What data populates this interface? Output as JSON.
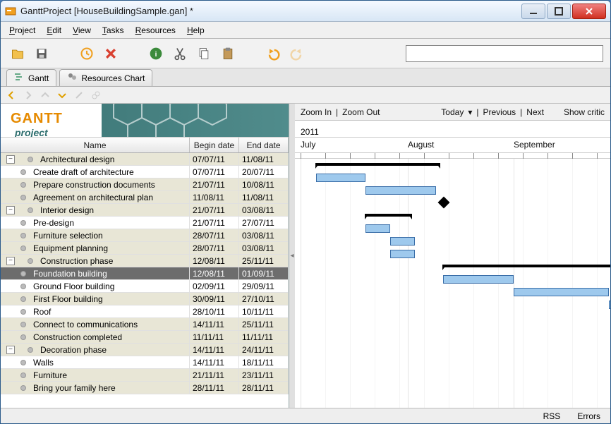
{
  "title": "GanttProject [HouseBuildingSample.gan] *",
  "menu": [
    "Project",
    "Edit",
    "View",
    "Tasks",
    "Resources",
    "Help"
  ],
  "menuAccel": [
    "P",
    "E",
    "V",
    "T",
    "R",
    "H"
  ],
  "tabs": {
    "gantt": "Gantt",
    "resources": "Resources Chart"
  },
  "tableHeaders": {
    "name": "Name",
    "begin": "Begin date",
    "end": "End date"
  },
  "timeline": {
    "zoomIn": "Zoom In",
    "zoomOut": "Zoom Out",
    "today": "Today",
    "previous": "Previous",
    "next": "Next",
    "showCritical": "Show critic",
    "year": "2011",
    "months": [
      "July",
      "August",
      "September"
    ]
  },
  "status": {
    "rss": "RSS",
    "errors": "Errors"
  },
  "logo": {
    "brand": "GANTT",
    "sub": "project"
  },
  "searchPlaceholder": "",
  "tasks": [
    {
      "lvl": 0,
      "exp": true,
      "name": "Architectural design",
      "begin": "07/07/11",
      "end": "11/08/11",
      "type": "summary",
      "start": 30,
      "dur": 175,
      "cls": "parent"
    },
    {
      "lvl": 1,
      "name": "Create draft of architecture",
      "begin": "07/07/11",
      "end": "20/07/11",
      "type": "bar",
      "start": 30,
      "dur": 70,
      "cls": ""
    },
    {
      "lvl": 1,
      "name": "Prepare construction documents",
      "begin": "21/07/11",
      "end": "10/08/11",
      "type": "bar",
      "start": 100,
      "dur": 100,
      "cls": "alt"
    },
    {
      "lvl": 1,
      "name": "Agreement on architectural plan",
      "begin": "11/08/11",
      "end": "11/08/11",
      "type": "milestone",
      "start": 205,
      "cls": "alt"
    },
    {
      "lvl": 0,
      "exp": true,
      "name": "Interior design",
      "begin": "21/07/11",
      "end": "03/08/11",
      "type": "summary",
      "start": 100,
      "dur": 65,
      "cls": "parent"
    },
    {
      "lvl": 1,
      "name": "Pre-design",
      "begin": "21/07/11",
      "end": "27/07/11",
      "type": "bar",
      "start": 100,
      "dur": 35,
      "cls": ""
    },
    {
      "lvl": 1,
      "name": "Furniture selection",
      "begin": "28/07/11",
      "end": "03/08/11",
      "type": "bar",
      "start": 135,
      "dur": 35,
      "cls": "alt"
    },
    {
      "lvl": 1,
      "name": "Equipment planning",
      "begin": "28/07/11",
      "end": "03/08/11",
      "type": "bar",
      "start": 135,
      "dur": 35,
      "cls": "alt"
    },
    {
      "lvl": 0,
      "exp": true,
      "name": "Construction phase",
      "begin": "12/08/11",
      "end": "25/11/11",
      "type": "summary",
      "start": 210,
      "dur": 420,
      "cls": "parent"
    },
    {
      "lvl": 1,
      "name": "Foundation building",
      "begin": "12/08/11",
      "end": "01/09/11",
      "type": "bar",
      "start": 210,
      "dur": 100,
      "cls": "sel",
      "selected": true
    },
    {
      "lvl": 1,
      "name": "Ground Floor building",
      "begin": "02/09/11",
      "end": "29/09/11",
      "type": "bar",
      "start": 310,
      "dur": 135,
      "cls": ""
    },
    {
      "lvl": 1,
      "name": "First Floor building",
      "begin": "30/09/11",
      "end": "27/10/11",
      "type": "bar",
      "start": 445,
      "dur": 140,
      "cls": "alt"
    },
    {
      "lvl": 1,
      "name": "Roof",
      "begin": "28/10/11",
      "end": "10/11/11",
      "type": "bar",
      "start": 585,
      "dur": 70,
      "cls": ""
    },
    {
      "lvl": 1,
      "name": "Connect to communications",
      "begin": "14/11/11",
      "end": "25/11/11",
      "type": "bar",
      "start": 660,
      "dur": 60,
      "cls": "alt"
    },
    {
      "lvl": 1,
      "name": "Construction completed",
      "begin": "11/11/11",
      "end": "11/11/11",
      "type": "milestone",
      "start": 655,
      "cls": "alt"
    },
    {
      "lvl": 0,
      "exp": true,
      "name": "Decoration phase",
      "begin": "14/11/11",
      "end": "24/11/11",
      "type": "summary",
      "start": 660,
      "dur": 55,
      "cls": "parent"
    },
    {
      "lvl": 1,
      "name": "Walls",
      "begin": "14/11/11",
      "end": "18/11/11",
      "type": "bar",
      "start": 660,
      "dur": 25,
      "cls": ""
    },
    {
      "lvl": 1,
      "name": "Furniture",
      "begin": "21/11/11",
      "end": "23/11/11",
      "type": "bar",
      "start": 695,
      "dur": 15,
      "cls": "alt"
    },
    {
      "lvl": 1,
      "name": "Bring your family here",
      "begin": "28/11/11",
      "end": "28/11/11",
      "type": "milestone",
      "start": 720,
      "cls": "alt"
    }
  ],
  "chart_data": {
    "type": "gantt",
    "title": "HouseBuildingSample",
    "time_axis": {
      "year": 2011,
      "months_visible": [
        "July",
        "August",
        "September"
      ]
    },
    "tasks": [
      {
        "name": "Architectural design",
        "start": "2011-07-07",
        "end": "2011-08-11",
        "summary": true,
        "children": [
          {
            "name": "Create draft of architecture",
            "start": "2011-07-07",
            "end": "2011-07-20"
          },
          {
            "name": "Prepare construction documents",
            "start": "2011-07-21",
            "end": "2011-08-10"
          },
          {
            "name": "Agreement on architectural plan",
            "start": "2011-08-11",
            "milestone": true
          }
        ]
      },
      {
        "name": "Interior design",
        "start": "2011-07-21",
        "end": "2011-08-03",
        "summary": true,
        "children": [
          {
            "name": "Pre-design",
            "start": "2011-07-21",
            "end": "2011-07-27"
          },
          {
            "name": "Furniture selection",
            "start": "2011-07-28",
            "end": "2011-08-03"
          },
          {
            "name": "Equipment planning",
            "start": "2011-07-28",
            "end": "2011-08-03"
          }
        ]
      },
      {
        "name": "Construction phase",
        "start": "2011-08-12",
        "end": "2011-11-25",
        "summary": true,
        "children": [
          {
            "name": "Foundation building",
            "start": "2011-08-12",
            "end": "2011-09-01",
            "selected": true
          },
          {
            "name": "Ground Floor building",
            "start": "2011-09-02",
            "end": "2011-09-29"
          },
          {
            "name": "First Floor building",
            "start": "2011-09-30",
            "end": "2011-10-27"
          },
          {
            "name": "Roof",
            "start": "2011-10-28",
            "end": "2011-11-10"
          },
          {
            "name": "Connect to communications",
            "start": "2011-11-14",
            "end": "2011-11-25"
          },
          {
            "name": "Construction completed",
            "start": "2011-11-11",
            "milestone": true
          }
        ]
      },
      {
        "name": "Decoration phase",
        "start": "2011-11-14",
        "end": "2011-11-24",
        "summary": true,
        "children": [
          {
            "name": "Walls",
            "start": "2011-11-14",
            "end": "2011-11-18"
          },
          {
            "name": "Furniture",
            "start": "2011-11-21",
            "end": "2011-11-23"
          },
          {
            "name": "Bring your family here",
            "start": "2011-11-28",
            "milestone": true
          }
        ]
      }
    ]
  }
}
